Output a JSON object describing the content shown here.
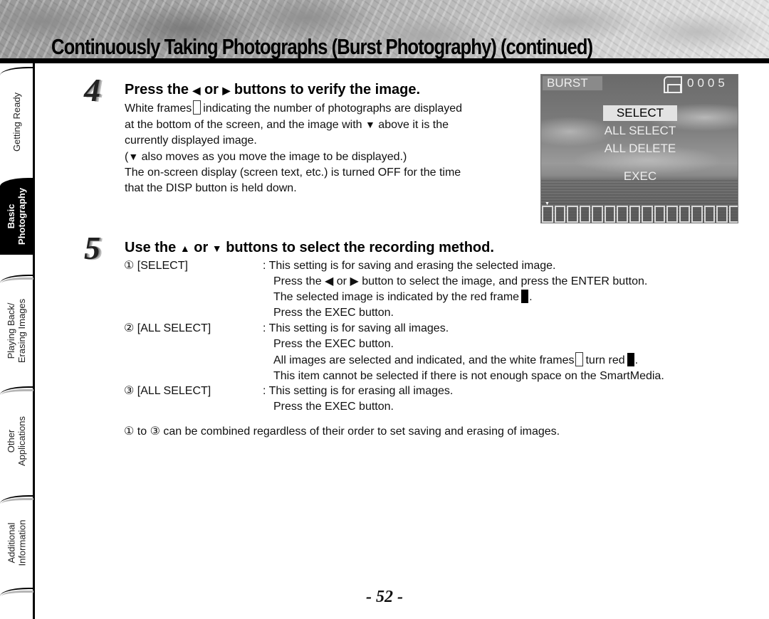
{
  "header": {
    "title": "Continuously Taking Photographs (Burst Photography) (continued)"
  },
  "side_tabs": [
    {
      "label_line1": "Getting Ready",
      "label_line2": "",
      "active": false
    },
    {
      "label_line1": "Basic",
      "label_line2": "Photography",
      "active": true
    },
    {
      "label_line1": "Playing Back/",
      "label_line2": "Erasing Images",
      "active": false
    },
    {
      "label_line1": "Other",
      "label_line2": "Applications",
      "active": false
    },
    {
      "label_line1": "Additional",
      "label_line2": "Information",
      "active": false
    }
  ],
  "step4": {
    "number": "4",
    "heading_prefix": "Press the ",
    "heading_left_arrow": "◀",
    "heading_or": " or ",
    "heading_right_arrow": "▶",
    "heading_suffix": " buttons to verify the image.",
    "line1_a": "White frames",
    "line1_b": "indicating the number of photographs are displayed",
    "line2_a": "at the bottom of the screen, and the image with ",
    "line2_arrow": "▼",
    "line2_b": " above it is the",
    "line3": "currently displayed image.",
    "line4_open": "(",
    "line4_arrow": "▼",
    "line4_b": " also moves as you move the image to be displayed.)",
    "line5": "The on-screen display (screen text, etc.) is turned OFF for the time",
    "line6": "that the DISP button is held down."
  },
  "lcd": {
    "mode": "BURST",
    "counter": "0005",
    "menu": [
      {
        "label": "SELECT",
        "selected": true
      },
      {
        "label": "ALL SELECT",
        "selected": false
      },
      {
        "label": "ALL DELETE",
        "selected": false
      },
      {
        "label": "EXEC",
        "selected": false
      }
    ],
    "thumbnail_count": 16,
    "current_thumbnail": 1,
    "cursor": "▼"
  },
  "step5": {
    "number": "5",
    "heading_prefix": "Use the ",
    "heading_up_arrow": "▲",
    "heading_or": " or ",
    "heading_down_arrow": "▼",
    "heading_suffix": " buttons to select the recording method.",
    "options": [
      {
        "label": "① [SELECT]",
        "lines": [
          ": This setting is for saving and erasing the selected image.",
          "Press the ◀ or ▶ button to select the image, and press the ENTER button.",
          "The selected image is indicated by the red frame",
          "Press the EXEC button."
        ]
      },
      {
        "label": "② [ALL SELECT]",
        "lines": [
          ": This setting is for saving all images.",
          "Press the EXEC button.",
          "All images are selected and indicated, and the white frames",
          "This item cannot be selected if there is not enough space on the SmartMedia."
        ],
        "turn_red_text": "turn red"
      },
      {
        "label": "③ [ALL SELECT]",
        "lines": [
          ": This setting is for erasing all images.",
          "Press the EXEC button."
        ]
      }
    ],
    "note": "① to ③ can be combined regardless of their order to set saving and erasing of images.",
    "period": "."
  },
  "footer": {
    "page_number": "- 52 -"
  }
}
